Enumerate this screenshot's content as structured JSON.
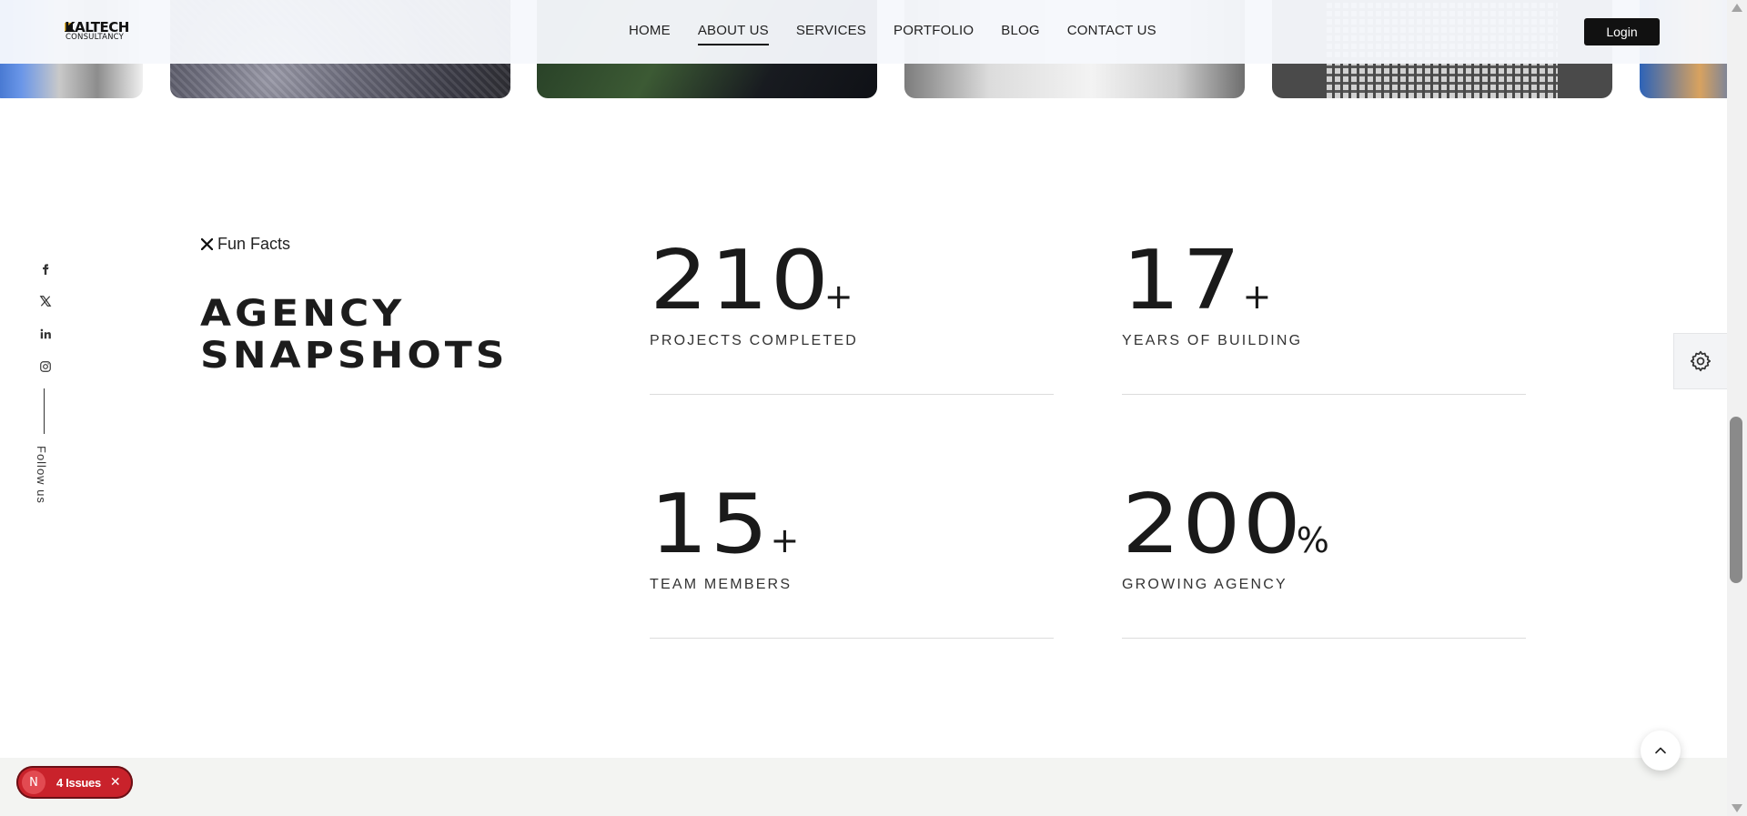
{
  "header": {
    "logo_top": "KALTECH",
    "logo_bottom": "CONSULTANCY",
    "nav": [
      "HOME",
      "ABOUT US",
      "SERVICES",
      "PORTFOLIO",
      "BLOG",
      "CONTACT US"
    ],
    "active_nav": "ABOUT US",
    "login_label": "Login"
  },
  "social": {
    "icons": [
      "facebook-icon",
      "x-icon",
      "linkedin-icon",
      "instagram-icon"
    ],
    "follow_label": "Follow us"
  },
  "funfacts": {
    "eyebrow": "Fun Facts",
    "heading_line1": "AGENCY",
    "heading_line2": "SNAPSHOTS",
    "stats": [
      {
        "value": "210",
        "suffix": "+",
        "label": "PROJECTS COMPLETED"
      },
      {
        "value": "17",
        "suffix": "+",
        "label": "YEARS OF BUILDING"
      },
      {
        "value": "15",
        "suffix": "+",
        "label": "TEAM MEMBERS"
      },
      {
        "value": "200",
        "suffix": "%",
        "label": "GROWING AGENCY"
      }
    ]
  },
  "issues_badge": {
    "avatar": "N",
    "label": "4 Issues"
  },
  "colors": {
    "accent": "#111111",
    "issues_red": "#c9222b",
    "divider": "#dcdcdc"
  }
}
